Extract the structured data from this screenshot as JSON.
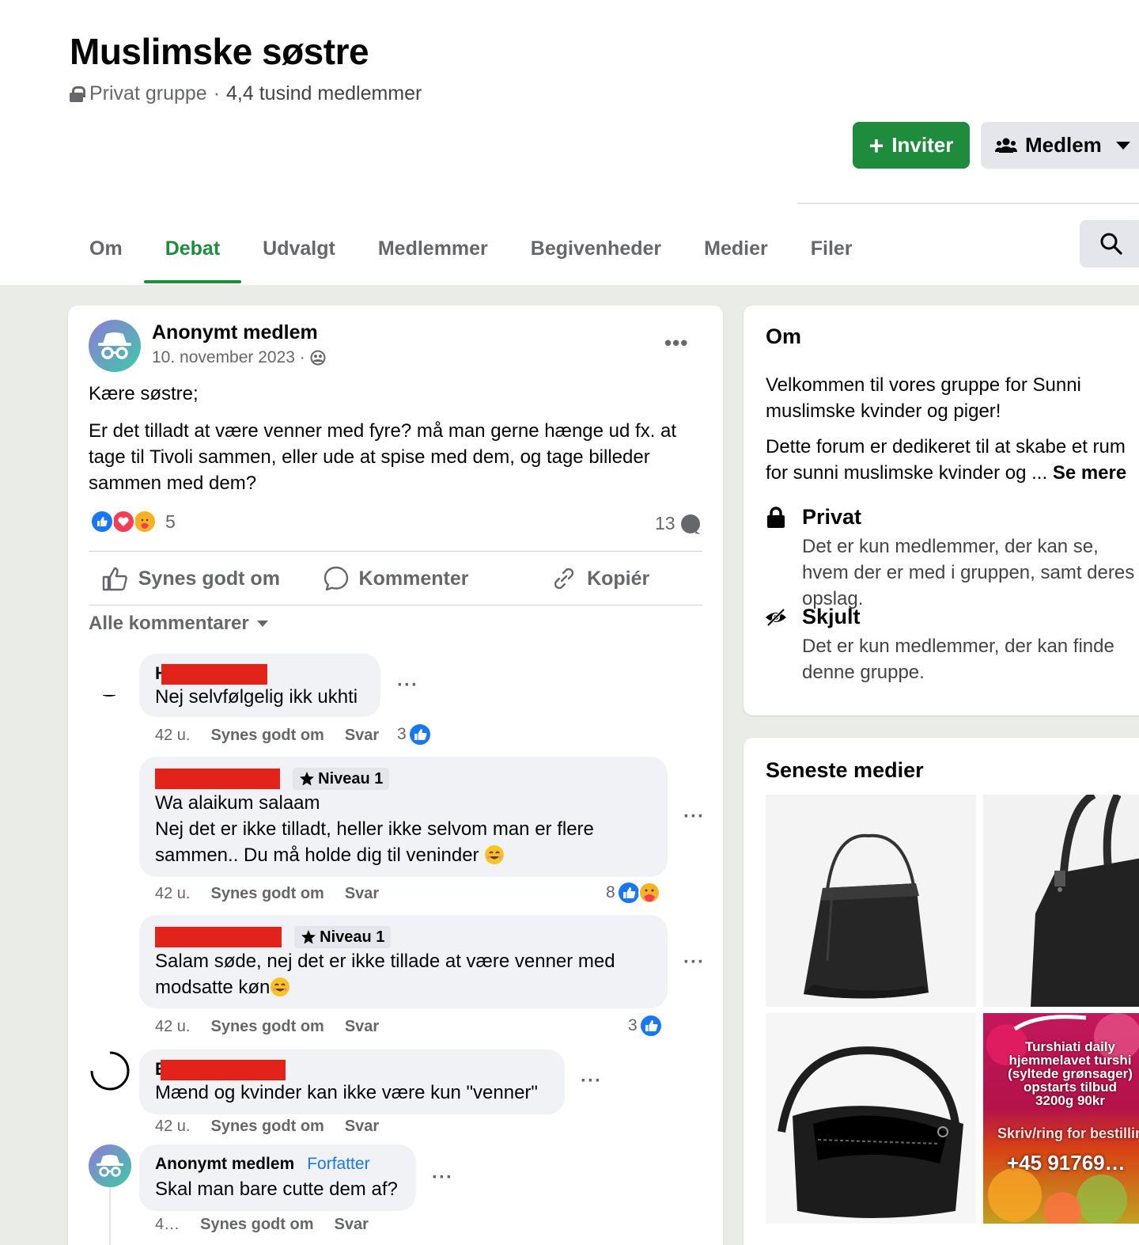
{
  "group": {
    "title": "Muslimske søstre",
    "privacy": "Privat gruppe",
    "separator": "·",
    "members": "4,4 tusind medlemmer"
  },
  "buttons": {
    "invite": "Inviter",
    "member": "Medlem"
  },
  "tabs": [
    {
      "label": "Om",
      "active": false
    },
    {
      "label": "Debat",
      "active": true
    },
    {
      "label": "Udvalgt",
      "active": false
    },
    {
      "label": "Medlemmer",
      "active": false
    },
    {
      "label": "Begivenheder",
      "active": false
    },
    {
      "label": "Medier",
      "active": false
    },
    {
      "label": "Filer",
      "active": false
    }
  ],
  "post": {
    "author": "Anonymt medlem",
    "date": "10. november 2023 ·",
    "greeting": "Kære søstre;",
    "body": "Er det tilladt at være venner med fyre? må man gerne hænge ud fx. at tage til Tivoli sammen, eller ude at spise med dem, og tage billeder sammen med dem?",
    "reaction_count": "5",
    "comment_count": "13",
    "actions": {
      "like": "Synes godt om",
      "comment": "Kommenter",
      "copy": "Kopiér"
    },
    "filter": "Alle kommentarer"
  },
  "comments": [
    {
      "name_initial": "H",
      "badge": "",
      "text": "Nej selvfølgelig ikk ukhti",
      "time": "42 u.",
      "like": "Synes godt om",
      "reply": "Svar",
      "likes": "3"
    },
    {
      "name_initial": "",
      "badge": "Niveau 1",
      "text_line1": "Wa alaikum salaam",
      "text": "Nej det er ikke tilladt, heller ikke selvom man er flere sammen.. Du må holde dig til veninder",
      "time": "42 u.",
      "like": "Synes godt om",
      "reply": "Svar",
      "likes": "8"
    },
    {
      "name_initial": "",
      "badge": "Niveau 1",
      "text": "Salam søde, nej det er ikke tillade at være venner med modsatte køn",
      "time": "42 u.",
      "like": "Synes godt om",
      "reply": "Svar",
      "likes": "3"
    },
    {
      "name_initial": "E",
      "badge": "",
      "text": "Mænd og kvinder kan ikke være kun \"venner\"",
      "time": "42 u.",
      "like": "Synes godt om",
      "reply": "Svar",
      "likes": ""
    },
    {
      "name": "Anonymt medlem",
      "author_tag": "Forfatter",
      "text": "Skal man bare cutte dem af?",
      "time": "4…",
      "like": "Synes godt om",
      "reply": "Svar"
    }
  ],
  "about": {
    "title": "Om",
    "p1": "Velkommen til vores gruppe for Sunni muslimske kvinder og piger!",
    "p2": "Dette forum er dedikeret til at skabe et rum for sunni muslimske kvinder og ...",
    "see_more": "Se mere",
    "private_title": "Privat",
    "private_text": "Det er kun medlemmer, der kan se, hvem der er med i gruppen, samt deres opslag.",
    "hidden_title": "Skjult",
    "hidden_text": "Det er kun medlemmer, der kan finde denne gruppe."
  },
  "media": {
    "title": "Seneste medier",
    "ad_line1": "Turshiati daily",
    "ad_line2": "hjemmelavet turshi",
    "ad_line3": "(syltede grønsager)",
    "ad_line4": "opstarts tilbud",
    "ad_line5": "3200g 90kr",
    "ad_line6": "Skriv/ring for bestilling",
    "ad_phone": "+45 91769…"
  },
  "colors": {
    "brand_green": "#1f8b3d",
    "like_blue": "#1877f2",
    "redaction": "#e2231a"
  }
}
